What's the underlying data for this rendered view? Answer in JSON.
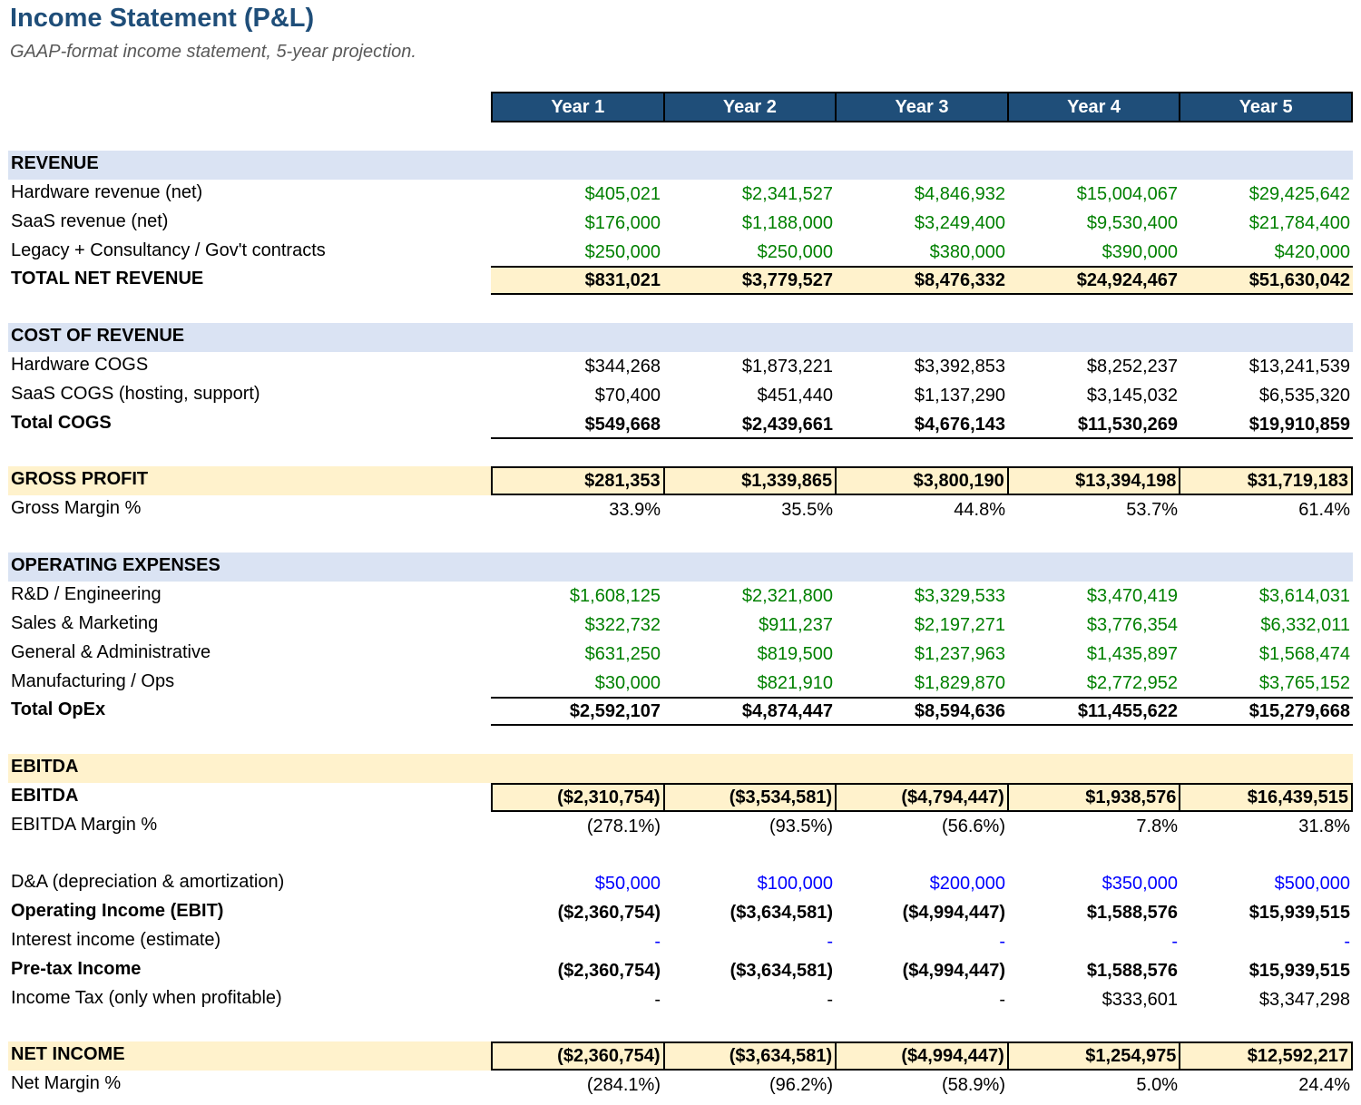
{
  "title": "Income Statement (P&L)",
  "subtitle": "GAAP-format income statement, 5-year projection.",
  "years": [
    "Year 1",
    "Year 2",
    "Year 3",
    "Year 4",
    "Year 5"
  ],
  "revenue": {
    "header": "REVENUE",
    "hardware": {
      "label": "Hardware revenue (net)",
      "values": [
        "$405,021",
        "$2,341,527",
        "$4,846,932",
        "$15,004,067",
        "$29,425,642"
      ]
    },
    "saas": {
      "label": "SaaS revenue (net)",
      "values": [
        "$176,000",
        "$1,188,000",
        "$3,249,400",
        "$9,530,400",
        "$21,784,400"
      ]
    },
    "legacy": {
      "label": "Legacy + Consultancy / Gov't contracts",
      "values": [
        "$250,000",
        "$250,000",
        "$380,000",
        "$390,000",
        "$420,000"
      ]
    },
    "total": {
      "label": "TOTAL NET REVENUE",
      "values": [
        "$831,021",
        "$3,779,527",
        "$8,476,332",
        "$24,924,467",
        "$51,630,042"
      ]
    }
  },
  "cogs": {
    "header": "COST OF REVENUE",
    "hardware": {
      "label": "Hardware COGS",
      "values": [
        "$344,268",
        "$1,873,221",
        "$3,392,853",
        "$8,252,237",
        "$13,241,539"
      ]
    },
    "saas": {
      "label": "SaaS COGS (hosting, support)",
      "values": [
        "$70,400",
        "$451,440",
        "$1,137,290",
        "$3,145,032",
        "$6,535,320"
      ]
    },
    "total": {
      "label": "Total COGS",
      "values": [
        "$549,668",
        "$2,439,661",
        "$4,676,143",
        "$11,530,269",
        "$19,910,859"
      ]
    }
  },
  "gross": {
    "profit": {
      "label": "GROSS PROFIT",
      "values": [
        "$281,353",
        "$1,339,865",
        "$3,800,190",
        "$13,394,198",
        "$31,719,183"
      ]
    },
    "margin": {
      "label": "Gross Margin %",
      "values": [
        "33.9%",
        "35.5%",
        "44.8%",
        "53.7%",
        "61.4%"
      ]
    }
  },
  "opex": {
    "header": "OPERATING EXPENSES",
    "rd": {
      "label": "R&D / Engineering",
      "values": [
        "$1,608,125",
        "$2,321,800",
        "$3,329,533",
        "$3,470,419",
        "$3,614,031"
      ]
    },
    "sm": {
      "label": "Sales & Marketing",
      "values": [
        "$322,732",
        "$911,237",
        "$2,197,271",
        "$3,776,354",
        "$6,332,011"
      ]
    },
    "ga": {
      "label": "General & Administrative",
      "values": [
        "$631,250",
        "$819,500",
        "$1,237,963",
        "$1,435,897",
        "$1,568,474"
      ]
    },
    "mfg": {
      "label": "Manufacturing / Ops",
      "values": [
        "$30,000",
        "$821,910",
        "$1,829,870",
        "$2,772,952",
        "$3,765,152"
      ]
    },
    "total": {
      "label": "Total OpEx",
      "values": [
        "$2,592,107",
        "$4,874,447",
        "$8,594,636",
        "$11,455,622",
        "$15,279,668"
      ]
    }
  },
  "ebitda": {
    "header": "EBITDA",
    "value": {
      "label": "EBITDA",
      "values": [
        "($2,310,754)",
        "($3,534,581)",
        "($4,794,447)",
        "$1,938,576",
        "$16,439,515"
      ]
    },
    "margin": {
      "label": "EBITDA Margin %",
      "values": [
        "(278.1%)",
        "(93.5%)",
        "(56.6%)",
        "7.8%",
        "31.8%"
      ]
    }
  },
  "below": {
    "da": {
      "label": "D&A (depreciation & amortization)",
      "values": [
        "$50,000",
        "$100,000",
        "$200,000",
        "$350,000",
        "$500,000"
      ]
    },
    "ebit": {
      "label": "Operating Income (EBIT)",
      "values": [
        "($2,360,754)",
        "($3,634,581)",
        "($4,994,447)",
        "$1,588,576",
        "$15,939,515"
      ]
    },
    "interest": {
      "label": "Interest income (estimate)",
      "values": [
        "-",
        "-",
        "-",
        "-",
        "-"
      ]
    },
    "pretax": {
      "label": "Pre-tax Income",
      "values": [
        "($2,360,754)",
        "($3,634,581)",
        "($4,994,447)",
        "$1,588,576",
        "$15,939,515"
      ]
    },
    "tax": {
      "label": "Income Tax (only when profitable)",
      "values": [
        "-",
        "-",
        "-",
        "$333,601",
        "$3,347,298"
      ]
    }
  },
  "net": {
    "income": {
      "label": "NET INCOME",
      "values": [
        "($2,360,754)",
        "($3,634,581)",
        "($4,994,447)",
        "$1,254,975",
        "$12,592,217"
      ]
    },
    "margin": {
      "label": "Net Margin %",
      "values": [
        "(284.1%)",
        "(96.2%)",
        "(58.9%)",
        "5.0%",
        "24.4%"
      ]
    }
  }
}
